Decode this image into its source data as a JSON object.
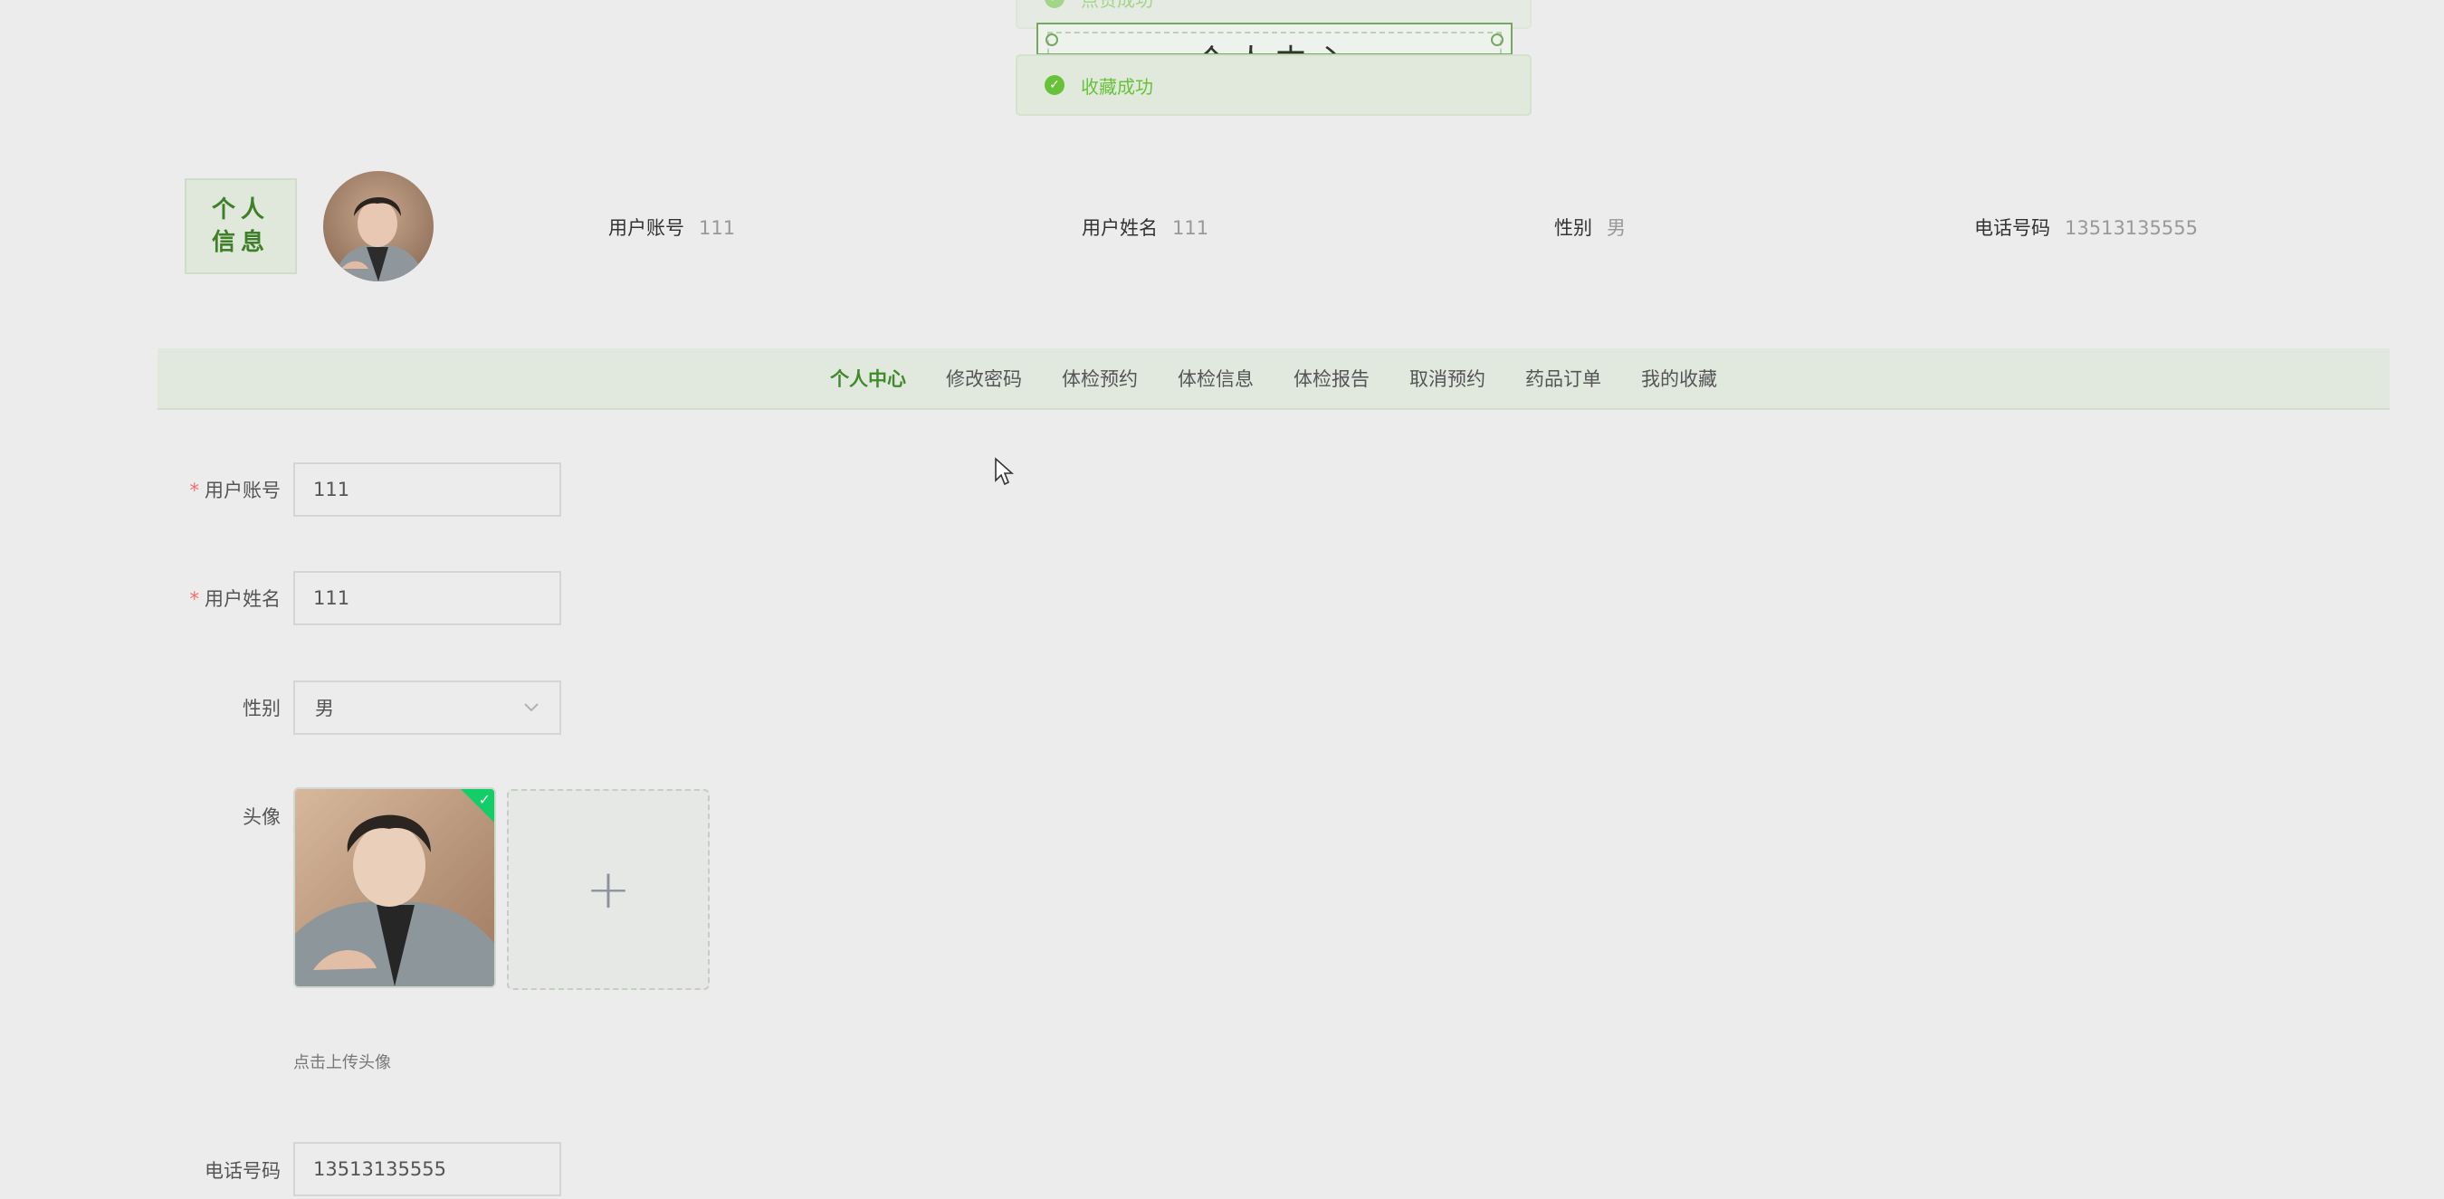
{
  "toasts": {
    "previous": "点赞成功",
    "current": "收藏成功"
  },
  "center_title": "个人中心",
  "profile": {
    "badge_line1": "个人",
    "badge_line2": "信息",
    "account_label": "用户账号",
    "account_value": "111",
    "name_label": "用户姓名",
    "name_value": "111",
    "gender_label": "性别",
    "gender_value": "男",
    "phone_label": "电话号码",
    "phone_value": "13513135555"
  },
  "nav": {
    "items": [
      {
        "label": "个人中心",
        "active": true
      },
      {
        "label": "修改密码",
        "active": false
      },
      {
        "label": "体检预约",
        "active": false
      },
      {
        "label": "体检信息",
        "active": false
      },
      {
        "label": "体检报告",
        "active": false
      },
      {
        "label": "取消预约",
        "active": false
      },
      {
        "label": "药品订单",
        "active": false
      },
      {
        "label": "我的收藏",
        "active": false
      }
    ]
  },
  "form": {
    "required_mark": "*",
    "account_label": "用户账号",
    "account_value": "111",
    "name_label": "用户姓名",
    "name_value": "111",
    "gender_label": "性别",
    "gender_value": "男",
    "avatar_label": "头像",
    "upload_plus": "+",
    "upload_tip": "点击上传头像",
    "phone_label": "电话号码",
    "phone_value": "13513135555"
  },
  "colors": {
    "accent": "#3f8a2e",
    "success": "#67c23a",
    "required": "#f56c6c"
  },
  "icons": {
    "toast": "check-circle-icon",
    "select": "chevron-down-icon",
    "upload_status": "check-icon",
    "upload_add": "plus-icon"
  }
}
